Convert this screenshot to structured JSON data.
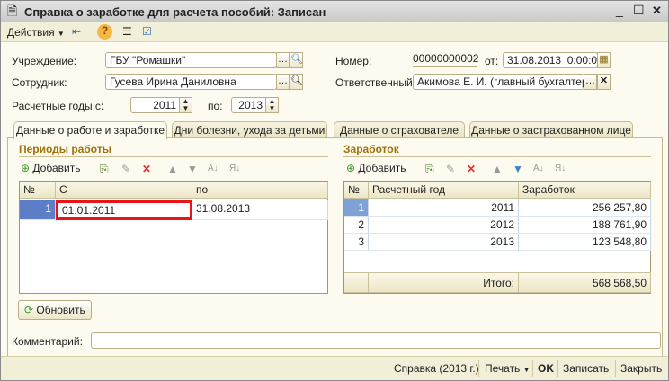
{
  "window": {
    "title": "Справка о заработке для расчета пособий: Записан",
    "controls": [
      "_",
      "☐",
      "✕"
    ]
  },
  "toolbar": {
    "actions_label": "Действия"
  },
  "form": {
    "institution_label": "Учреждение:",
    "institution_value": "ГБУ \"Ромашки\"",
    "employee_label": "Сотрудник:",
    "employee_value": "Гусева Ирина Даниловна",
    "years_label": "Расчетные годы с:",
    "year_from": "2011",
    "to_label": "по:",
    "year_to": "2013",
    "number_label": "Номер:",
    "number_value": "00000000002",
    "date_label": "от:",
    "date_value": "31.08.2013  0:00:00",
    "responsible_label": "Ответственный:",
    "responsible_value": "Акимова Е. И. (главный бухгалтер)",
    "comment_label": "Комментарий:",
    "comment_value": ""
  },
  "tabs": [
    {
      "label": "Данные о работе и заработке",
      "active": true
    },
    {
      "label": "Дни болезни, ухода за детьми"
    },
    {
      "label": "Данные о страхователе"
    },
    {
      "label": "Данные о застрахованном лице"
    }
  ],
  "periods": {
    "title": "Периоды работы",
    "add_label": "Добавить",
    "columns": [
      "№",
      "С",
      "по"
    ],
    "rows": [
      {
        "n": "1",
        "from": "01.01.2011",
        "to": "31.08.2013"
      }
    ]
  },
  "earnings": {
    "title": "Заработок",
    "add_label": "Добавить",
    "columns": [
      "№",
      "Расчетный год",
      "Заработок"
    ],
    "rows": [
      {
        "n": "1",
        "year": "2011",
        "amount": "256 257,80"
      },
      {
        "n": "2",
        "year": "2012",
        "amount": "188 761,90"
      },
      {
        "n": "3",
        "year": "2013",
        "amount": "123 548,80"
      }
    ],
    "total_label": "Итого:",
    "total": "568 568,50"
  },
  "refresh_label": "Обновить",
  "statusbar": {
    "certificate": "Справка (2013 г.)",
    "print": "Печать",
    "ok": "OK",
    "save": "Записать",
    "close": "Закрыть"
  },
  "highlight_color": "#e8131b"
}
